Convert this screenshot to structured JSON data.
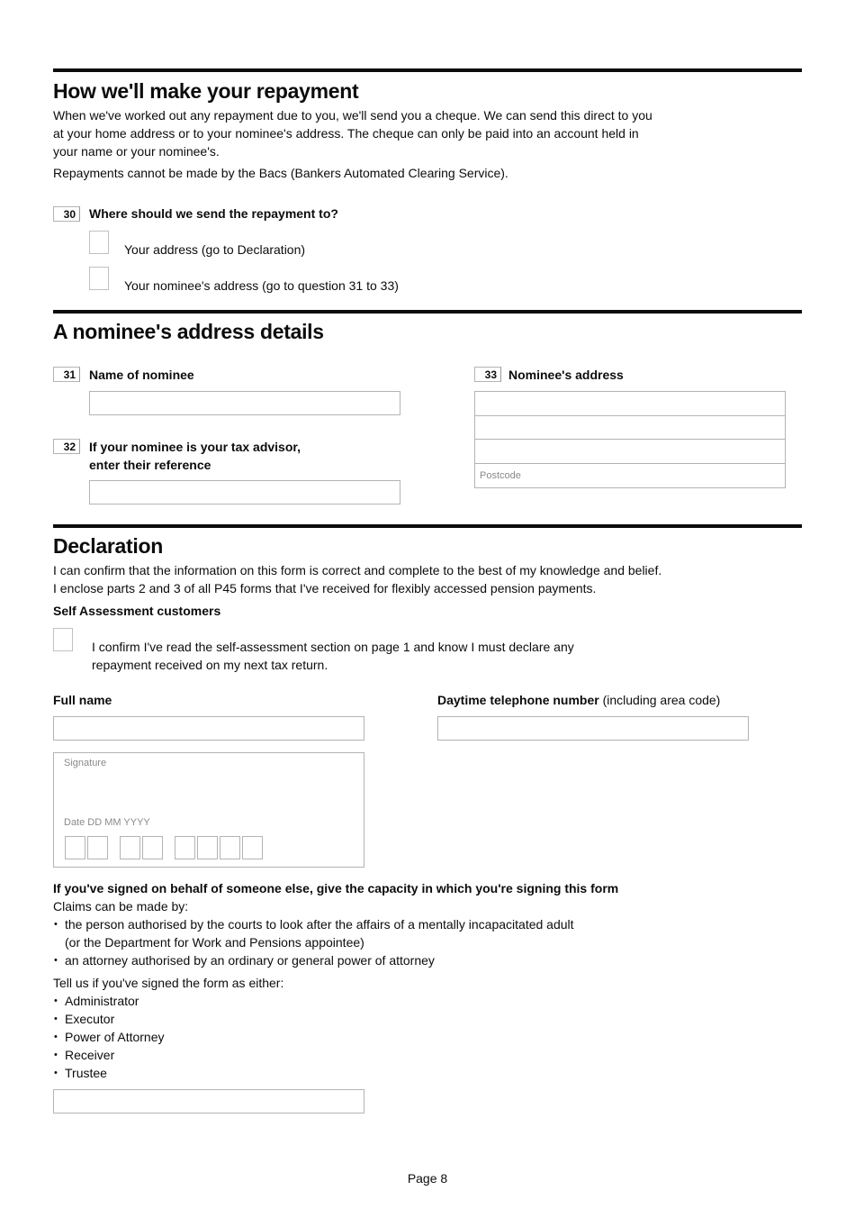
{
  "repayment": {
    "heading": "How we'll make your repayment",
    "intro_lines": [
      "When we've worked out any repayment due to you, we'll send you a cheque. We can send this direct to you",
      "at your home address or to your nominee's address. The cheque can only be paid into an account held in",
      "your name or your nominee's."
    ],
    "bacs_note": "Repayments cannot be made by the Bacs (Bankers Automated Clearing Service).",
    "q30": {
      "number": "30",
      "label": "Where should we send the repayment to?",
      "options": [
        {
          "label": "Your address (go to Declaration)",
          "checked": false
        },
        {
          "label": "Your nominee's address (go to question 31 to 33)",
          "checked": false
        }
      ]
    }
  },
  "nominee": {
    "heading": "A nominee's address details",
    "q31": {
      "number": "31",
      "label": "Name of nominee",
      "value": ""
    },
    "q32": {
      "number": "32",
      "label_line1": "If your nominee is your tax advisor,",
      "label_line2": "enter their reference",
      "value": ""
    },
    "q33": {
      "number": "33",
      "label": "Nominee's address",
      "lines": [
        "",
        "",
        ""
      ],
      "postcode_placeholder": "Postcode"
    }
  },
  "declaration": {
    "heading": "Declaration",
    "line1": "I can confirm that the information on this form is correct and complete to the best of my knowledge and belief.",
    "line2": "I enclose parts 2 and 3 of all P45 forms that I've received for flexibly accessed pension payments.",
    "sa_heading": "Self Assessment customers",
    "sa_confirm_line1": "I confirm I've read the self-assessment section on page 1 and know I must declare any",
    "sa_confirm_line2": "repayment received on my next tax return.",
    "sa_checked": false,
    "full_name_label": "Full name",
    "full_name_value": "",
    "phone_label_bold": "Daytime telephone number",
    "phone_label_note": " (including area code)",
    "phone_value": "",
    "signature_label": "Signature",
    "date_label": "Date  DD MM YYYY",
    "capacity_heading": "If you've signed on behalf of someone else, give the capacity in which you're signing this form",
    "claims_intro": "Claims can be made by:",
    "claims": [
      {
        "line1": "the person authorised by the courts to look after the affairs of a mentally incapacitated adult",
        "line2": "(or the Department for Work and Pensions appointee)"
      },
      {
        "line1": "an attorney authorised by an ordinary or general power of attorney"
      }
    ],
    "either_intro": "Tell us if you've signed the form as either:",
    "capacities": [
      "Administrator",
      "Executor",
      "Power of Attorney",
      "Receiver",
      "Trustee"
    ],
    "capacity_value": ""
  },
  "footer": {
    "page": "Page 8"
  }
}
